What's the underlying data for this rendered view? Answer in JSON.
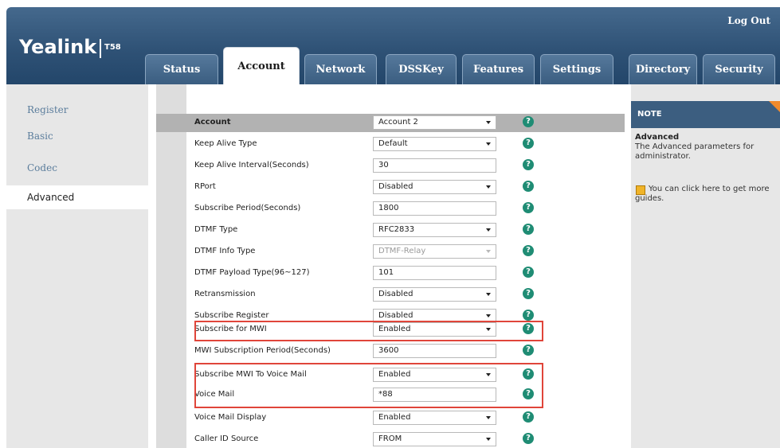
{
  "header": {
    "logo": "Yealink",
    "model": "T58",
    "logout": "Log Out",
    "tabs": [
      {
        "label": "Status"
      },
      {
        "label": "Account"
      },
      {
        "label": "Network"
      },
      {
        "label": "DSSKey"
      },
      {
        "label": "Features"
      },
      {
        "label": "Settings"
      },
      {
        "label": "Directory"
      },
      {
        "label": "Security"
      }
    ],
    "active_tab": "Account"
  },
  "sidebar": {
    "items": [
      {
        "label": "Register"
      },
      {
        "label": "Basic"
      },
      {
        "label": "Codec"
      },
      {
        "label": "Advanced"
      }
    ],
    "active_item": "Advanced"
  },
  "form": {
    "rows": [
      {
        "label": "Account",
        "value": "Account 2",
        "type": "select"
      },
      {
        "label": "Keep Alive Type",
        "value": "Default",
        "type": "select"
      },
      {
        "label": "Keep Alive Interval(Seconds)",
        "value": "30",
        "type": "input"
      },
      {
        "label": "RPort",
        "value": "Disabled",
        "type": "select"
      },
      {
        "label": "Subscribe Period(Seconds)",
        "value": "1800",
        "type": "input"
      },
      {
        "label": "DTMF Type",
        "value": "RFC2833",
        "type": "select"
      },
      {
        "label": "DTMF Info Type",
        "value": "DTMF-Relay",
        "type": "select",
        "disabled": true
      },
      {
        "label": "DTMF Payload Type(96~127)",
        "value": "101",
        "type": "input"
      },
      {
        "label": "Retransmission",
        "value": "Disabled",
        "type": "select"
      },
      {
        "label": "Subscribe Register",
        "value": "Disabled",
        "type": "select"
      },
      {
        "label": "Subscribe for MWI",
        "value": "Enabled",
        "type": "select"
      },
      {
        "label": "MWI Subscription Period(Seconds)",
        "value": "3600",
        "type": "input"
      },
      {
        "label": "Subscribe MWI To Voice Mail",
        "value": "Enabled",
        "type": "select"
      },
      {
        "label": "Voice Mail",
        "value": "*88",
        "type": "input"
      },
      {
        "label": "Voice Mail Display",
        "value": "Enabled",
        "type": "select"
      },
      {
        "label": "Caller ID Source",
        "value": "FROM",
        "type": "select"
      }
    ],
    "help_glyph": "?"
  },
  "note": {
    "header": "NOTE",
    "title": "Advanced",
    "text": "The Advanced parameters for administrator.",
    "guide_text": "You can click here to get more guides."
  },
  "colors": {
    "header_blue": "#2f5276",
    "help_green": "#1f8c74",
    "highlight_red": "#e0453a",
    "note_accent": "#f08a2c"
  }
}
